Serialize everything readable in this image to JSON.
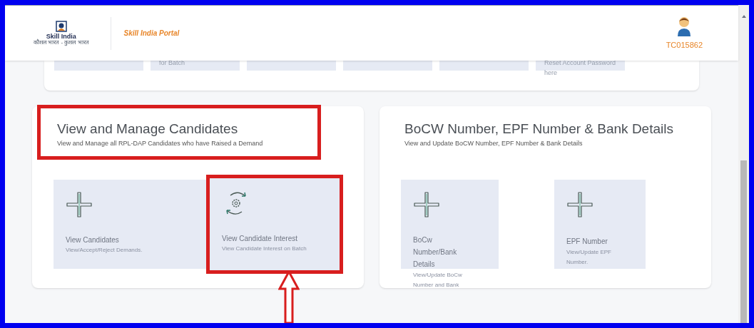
{
  "header": {
    "logo_text": "Skill India",
    "logo_tagline": "कौशल भारत - कुशल भारत",
    "portal_title": "Skill India Portal",
    "user_id": "TC015862"
  },
  "top_card": {
    "tiles": [
      {
        "kind": "blank"
      },
      {
        "kind": "text",
        "text": "for Batch"
      },
      {
        "kind": "blank"
      },
      {
        "kind": "blank"
      },
      {
        "kind": "blank"
      },
      {
        "kind": "text",
        "text": "Reset Account Password here"
      }
    ]
  },
  "sections": [
    {
      "title": "View and Manage Candidates",
      "subtitle": "View and Manage all RPL-DAP Candidates who have Raised a Demand",
      "highlighted": true,
      "tiles": [
        {
          "kind": "add",
          "title": "View Candidates",
          "description": "View/Accept/Reject Demands.",
          "highlighted": false
        },
        {
          "kind": "sync",
          "title": "View Candidate Interest",
          "description": "View Candidate Interest on Batch",
          "highlighted": true
        }
      ]
    },
    {
      "title": "BoCW Number, EPF Number & Bank Details",
      "subtitle": "View and Update BoCW Number, EPF Number & Bank Details",
      "highlighted": false,
      "tiles": [
        {
          "kind": "add",
          "title": "BoCw Number/Bank Details",
          "description": "View/Update BoCw Number and Bank",
          "highlighted": false
        },
        {
          "kind": "add",
          "title": "EPF Number",
          "description": "View/Update EPF Number.",
          "highlighted": false
        }
      ]
    }
  ]
}
